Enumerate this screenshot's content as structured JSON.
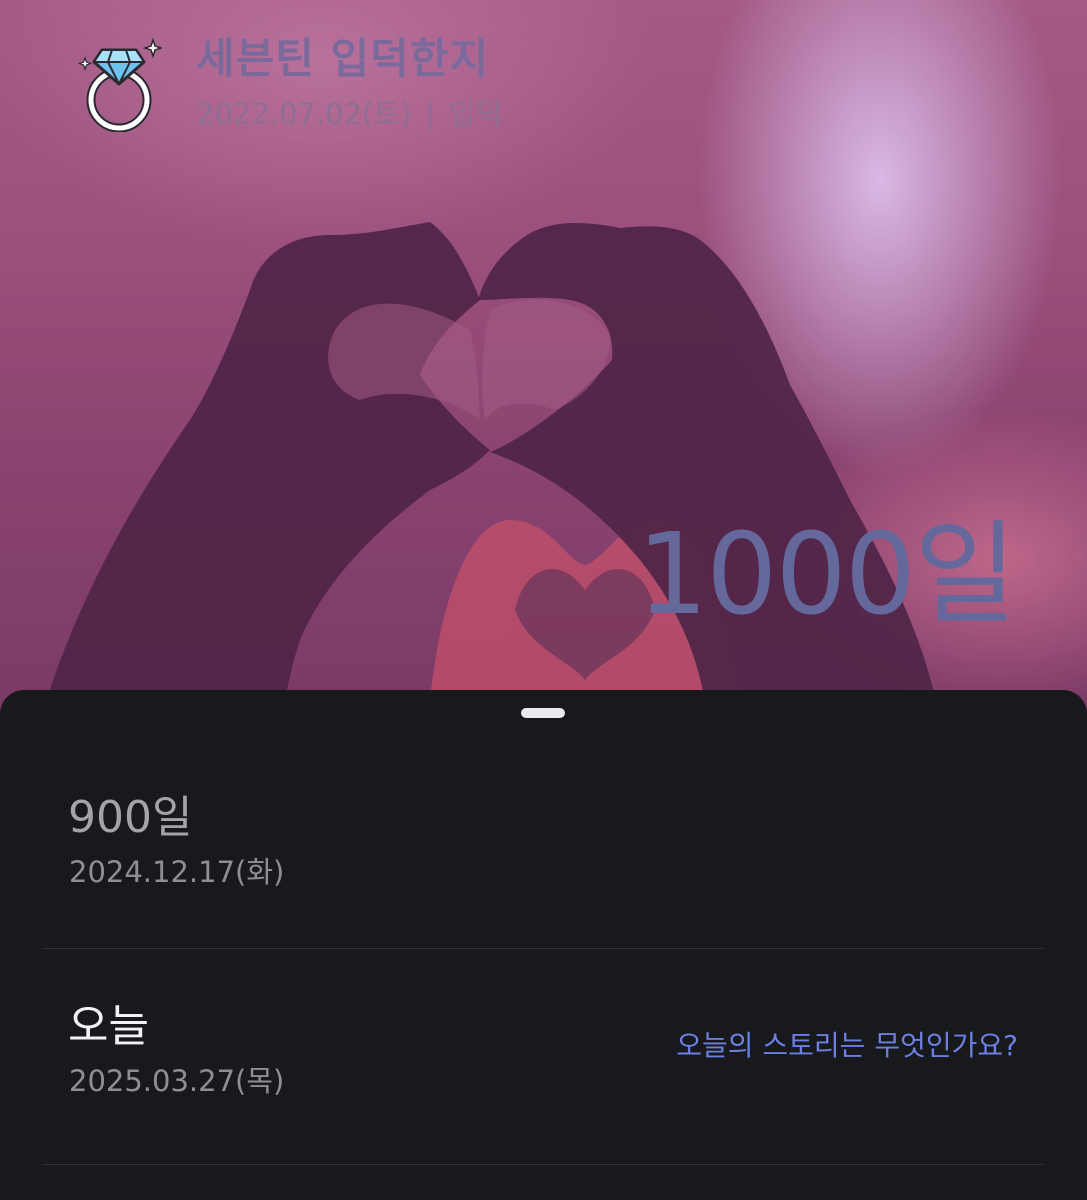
{
  "header": {
    "title": "세븐틴 입덕한지",
    "date": "2022.07.02(토)",
    "separator": "|",
    "event": "입덕",
    "icon": "diamond-ring-icon"
  },
  "hero": {
    "count_label": "1000일"
  },
  "sheet": {
    "milestones": [
      {
        "label": "900일",
        "date": "2024.12.17(화)"
      },
      {
        "label": "오늘",
        "date": "2025.03.27(목)",
        "action": "오늘의 스토리는 무엇인가요?"
      }
    ]
  },
  "colors": {
    "accent_link": "#6d7fe0",
    "count_text": "#64689a",
    "sheet_background": "#18191d"
  }
}
